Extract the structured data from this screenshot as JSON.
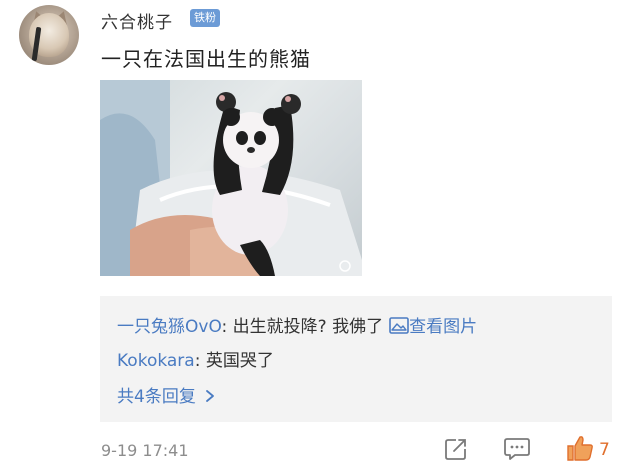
{
  "post": {
    "username": "六合桃子",
    "badge": "铁粉",
    "text": "一只在法国出生的熊猫",
    "timestamp": "9-19 17:41"
  },
  "replies": {
    "items": [
      {
        "user": "一只兔猻OvO",
        "sep": ": ",
        "text": "出生就投降? 我佛了",
        "link": "查看图片"
      },
      {
        "user": "Kokokara",
        "sep": ": ",
        "text": "英国哭了"
      }
    ],
    "more": "共4条回复 "
  },
  "actions": {
    "like_count": "7"
  },
  "icons": {
    "share": "share-icon",
    "comment": "comment-icon",
    "like": "thumbs-up-icon",
    "image_link": "image-icon",
    "more": "chevron-right-icon"
  },
  "colors": {
    "link_blue": "#4a7bc2",
    "badge_blue": "#6c9bd6",
    "like_orange": "#e06f2d"
  }
}
